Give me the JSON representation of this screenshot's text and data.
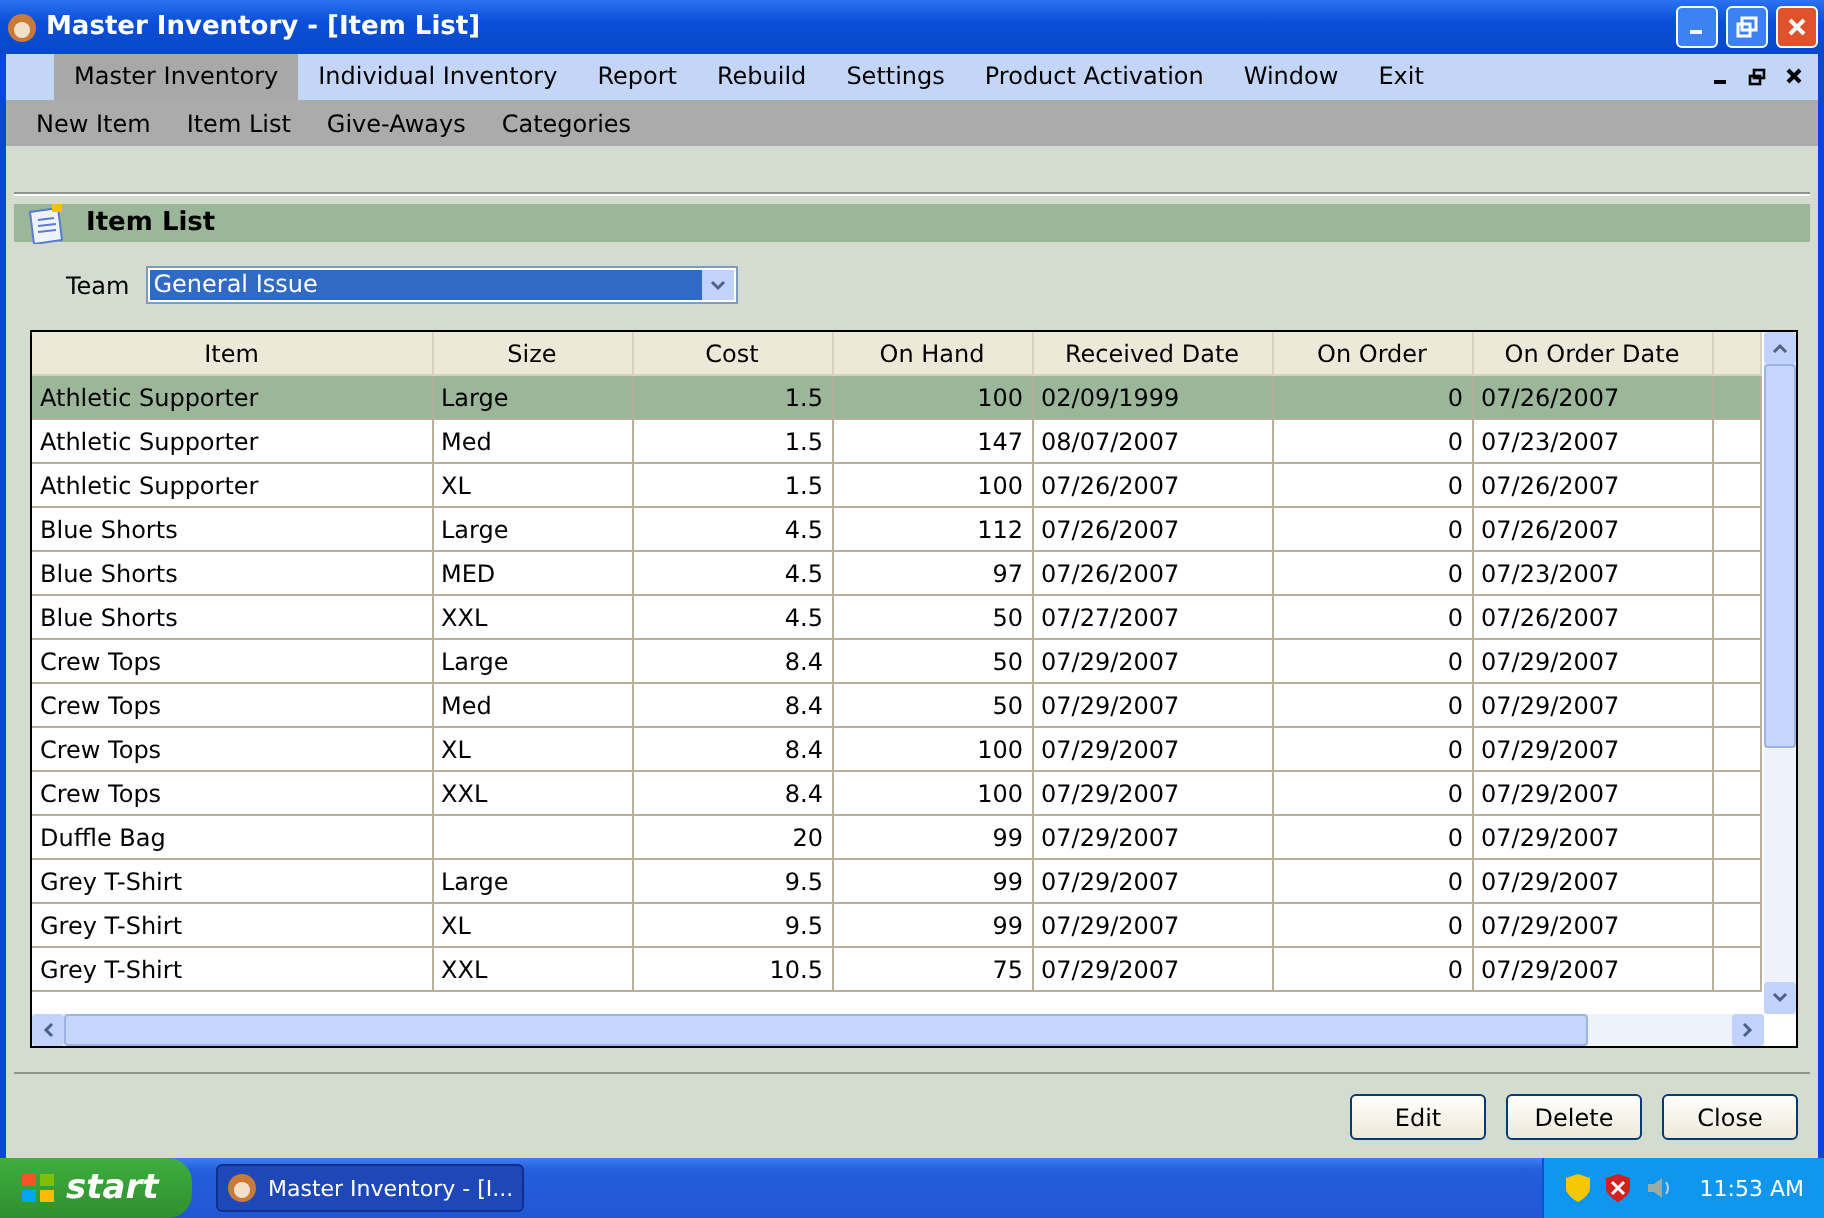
{
  "window": {
    "title": "Master Inventory - [Item List]"
  },
  "menu": [
    {
      "label": "Master Inventory",
      "selected": true
    },
    {
      "label": "Individual Inventory",
      "selected": false
    },
    {
      "label": "Report",
      "selected": false
    },
    {
      "label": "Rebuild",
      "selected": false
    },
    {
      "label": "Settings",
      "selected": false
    },
    {
      "label": "Product Activation",
      "selected": false
    },
    {
      "label": "Window",
      "selected": false
    },
    {
      "label": "Exit",
      "selected": false
    }
  ],
  "submenu": [
    "New Item",
    "Item List",
    "Give-Aways",
    "Categories"
  ],
  "section": {
    "title": "Item List"
  },
  "team": {
    "label": "Team",
    "value": "General Issue"
  },
  "table": {
    "columns": [
      "Item",
      "Size",
      "Cost",
      "On Hand",
      "Received Date",
      "On Order",
      "On Order Date"
    ],
    "rows": [
      {
        "cells": [
          "Athletic Supporter",
          "Large",
          "1.5",
          "100",
          "02/09/1999",
          "0",
          "07/26/2007"
        ],
        "selected": true
      },
      {
        "cells": [
          "Athletic Supporter",
          "Med",
          "1.5",
          "147",
          "08/07/2007",
          "0",
          "07/23/2007"
        ],
        "selected": false
      },
      {
        "cells": [
          "Athletic Supporter",
          "XL",
          "1.5",
          "100",
          "07/26/2007",
          "0",
          "07/26/2007"
        ],
        "selected": false
      },
      {
        "cells": [
          "Blue Shorts",
          "Large",
          "4.5",
          "112",
          "07/26/2007",
          "0",
          "07/26/2007"
        ],
        "selected": false
      },
      {
        "cells": [
          "Blue Shorts",
          "MED",
          "4.5",
          "97",
          "07/26/2007",
          "0",
          "07/23/2007"
        ],
        "selected": false
      },
      {
        "cells": [
          "Blue Shorts",
          "XXL",
          "4.5",
          "50",
          "07/27/2007",
          "0",
          "07/26/2007"
        ],
        "selected": false
      },
      {
        "cells": [
          "Crew Tops",
          "Large",
          "8.4",
          "50",
          "07/29/2007",
          "0",
          "07/29/2007"
        ],
        "selected": false
      },
      {
        "cells": [
          "Crew Tops",
          "Med",
          "8.4",
          "50",
          "07/29/2007",
          "0",
          "07/29/2007"
        ],
        "selected": false
      },
      {
        "cells": [
          "Crew Tops",
          "XL",
          "8.4",
          "100",
          "07/29/2007",
          "0",
          "07/29/2007"
        ],
        "selected": false
      },
      {
        "cells": [
          "Crew Tops",
          "XXL",
          "8.4",
          "100",
          "07/29/2007",
          "0",
          "07/29/2007"
        ],
        "selected": false
      },
      {
        "cells": [
          "Duffle Bag",
          "",
          "20",
          "99",
          "07/29/2007",
          "0",
          "07/29/2007"
        ],
        "selected": false
      },
      {
        "cells": [
          "Grey T-Shirt",
          "Large",
          "9.5",
          "99",
          "07/29/2007",
          "0",
          "07/29/2007"
        ],
        "selected": false
      },
      {
        "cells": [
          "Grey T-Shirt",
          "XL",
          "9.5",
          "99",
          "07/29/2007",
          "0",
          "07/29/2007"
        ],
        "selected": false
      },
      {
        "cells": [
          "Grey T-Shirt",
          "XXL",
          "10.5",
          "75",
          "07/29/2007",
          "0",
          "07/29/2007"
        ],
        "selected": false
      }
    ]
  },
  "buttons": [
    "Edit",
    "Delete",
    "Close"
  ],
  "taskbar": {
    "start": "start",
    "task": "Master Inventory - [I...",
    "clock": "11:53 AM"
  }
}
